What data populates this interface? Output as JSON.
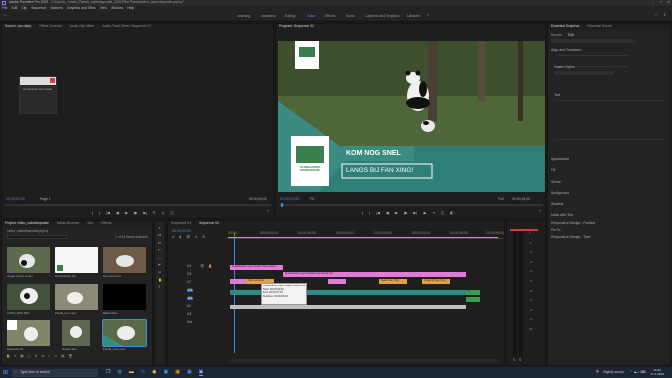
{
  "window": {
    "app_name": "Adobe Premiere Pro 2022",
    "path": "C:\\Users\\...\\video_Panda_cakeekspostie_2021\\Film Panda\\video_cakeekspostie.prproj *"
  },
  "menu": [
    "File",
    "Edit",
    "Clip",
    "Sequence",
    "Markers",
    "Graphics and Titles",
    "View",
    "Window",
    "Help"
  ],
  "workspaces": [
    "Learning",
    "Assembly",
    "Editing",
    "Color",
    "Effects",
    "Audio",
    "Captions and Graphics",
    "Libraries"
  ],
  "source_panel": {
    "tabs": [
      "Source: (no clips)",
      "Effect Controls",
      "Audio Clip Mixer",
      "Audio Track Mixer: Sequence 01"
    ],
    "thumb_caption": "Ouwehands dierenpark",
    "timecode": "00;00;00;00",
    "page": "Page 1",
    "timecode_end": "00;00;00;00"
  },
  "program_panel": {
    "tab": "Program: Sequence 01",
    "headline": "KOM NOG SNEL",
    "subline": "LANGS BIJ FAN XING!",
    "logo_text": "OUWEHANDS DIERENPARK",
    "timecode": "00;00;03;00",
    "fit": "Fit",
    "full": "Full",
    "timecode_end": "00;00;15;00"
  },
  "right_panel": {
    "tabs": [
      "Essential Graphics",
      "Essential Sound"
    ],
    "labels": [
      "Browse",
      "Edit",
      "Align and Transform",
      "Master Styles",
      "Text",
      "Appearance",
      "Fill",
      "Stroke",
      "Background",
      "Shadow",
      "Mask with Text",
      "Responsive Design - Position",
      "Pin To",
      "Responsive Design - Time"
    ]
  },
  "project_panel": {
    "tabs": [
      "Project: video_cakeekspostie",
      "Media Browser",
      "Info",
      "Effects"
    ],
    "path": "video_cakeekspostie.prproj",
    "items_count": "1 of 12 items selected",
    "items": [
      {
        "label": "Jungle 4 lines of text",
        "dur": "5;00"
      },
      {
        "label": "Ouwehands_dier",
        "dur": "5;00"
      },
      {
        "label": "Lite moment 6",
        "dur": "5;11"
      },
      {
        "label": "C3ADI_0001.MP4",
        "dur": "5;00"
      },
      {
        "label": "Panda_tree.mp4",
        "dur": "5;15"
      },
      {
        "label": "Black Video",
        "dur": "5;00"
      },
      {
        "label": "Sequence 01",
        "dur": "15;00"
      },
      {
        "label": "Nested Seq",
        "dur": "5;00"
      },
      {
        "label": "Panda_main.mp4",
        "dur": "10;00"
      }
    ]
  },
  "timeline": {
    "tabs": [
      "Sequence 01",
      "Sequence 02"
    ],
    "timecode": "00;00;03;00",
    "ruler": [
      "00;00",
      "00;00;05;00",
      "00;00;10;00",
      "00;00;15;00",
      "00;00;20;00",
      "00;00;25;00",
      "00;00;30;00",
      "00;00;35;00"
    ],
    "tracks": [
      "V4",
      "V3",
      "V2",
      "V1",
      "A1",
      "A2",
      "A3",
      "Mix"
    ],
    "clip_labels": [
      "Ouwehands Logo Sneak Chaos Action",
      "Ouwehands Logo Sneak/Loop Panda Fan",
      "Kom nog snel",
      "Naam Fan Xing",
      "Langs bij Fan Xing",
      "Ouwehands",
      "fx"
    ],
    "tooltip": {
      "line1": "Ouwehands Logo Sneak Chaos Action...",
      "line2": "Start: 00;00;03;00",
      "line3": "End: 00;00;07;15",
      "line4": "Duration: 00;00;04;15"
    }
  },
  "audio_meters": {
    "scale": [
      "0",
      "-6",
      "-12",
      "-18",
      "-24",
      "-30",
      "-36",
      "-42",
      "-48",
      "-54",
      "dB"
    ],
    "labels": [
      "S",
      "S"
    ]
  },
  "taskbar": {
    "search": "Type here to search",
    "weather": "Slightly sunny",
    "time": "15:26",
    "date": "27-1-2023"
  },
  "colors": {
    "accent": "#3a8dde",
    "pink": "#e27ad7",
    "orange": "#e6a040",
    "teal": "#2f8a83",
    "green": "#3c9a4e"
  }
}
